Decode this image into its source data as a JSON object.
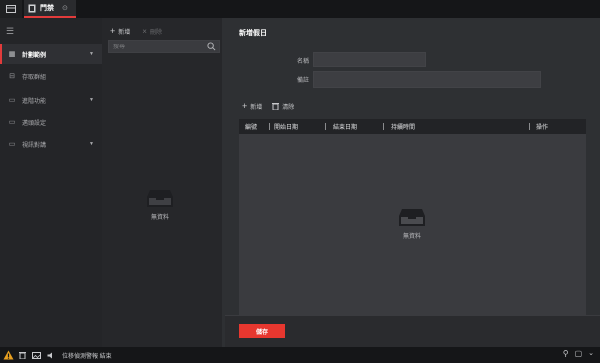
{
  "topbar": {
    "tab_label": "門禁"
  },
  "sidebar": {
    "items": [
      {
        "label": "計劃範例",
        "expandable": true,
        "active": true,
        "icon": "calendar-icon"
      },
      {
        "label": "存取群組",
        "expandable": false,
        "active": false,
        "icon": "lock-icon"
      },
      {
        "label": "進階功能",
        "expandable": true,
        "active": false,
        "icon": "advanced-icon"
      },
      {
        "label": "邁頭設定",
        "expandable": false,
        "active": false,
        "icon": "door-icon"
      },
      {
        "label": "視訊對講",
        "expandable": true,
        "active": false,
        "icon": "intercom-icon"
      }
    ]
  },
  "list_panel": {
    "add_label": "新增",
    "delete_label": "刪除",
    "search_placeholder": "搜尋",
    "empty_label": "無資料"
  },
  "main": {
    "title": "新增假日",
    "name_label": "名稱",
    "name_value": "",
    "remark_label": "備註",
    "remark_value": "",
    "add_label": "新增",
    "clear_label": "清除",
    "table": {
      "columns": [
        "編號",
        "開始日期",
        "結束日期",
        "持續時間",
        "操作"
      ],
      "rows": [],
      "empty_label": "無資料"
    },
    "save_label": "儲存"
  },
  "statusbar": {
    "message": "位移偵測警報 結束"
  },
  "colors": {
    "accent": "#e23b3b",
    "save_button": "#e7372f",
    "background": "#2e3033",
    "sidebar": "#242528",
    "topbar": "#151618"
  }
}
